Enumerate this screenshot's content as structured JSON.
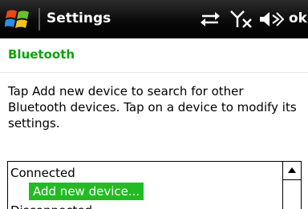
{
  "titlebar": {
    "title": "Settings",
    "ok_label": "ok",
    "start_icon": "windows-flag-icon",
    "status_icons": [
      "sync-arrows-icon",
      "no-signal-icon",
      "volume-muted-icon"
    ]
  },
  "section": {
    "title": "Bluetooth"
  },
  "description": "Tap Add new device to search for other Bluetooth devices. Tap on a device to modify its settings.",
  "device_list": {
    "group_connected": "Connected",
    "add_new_device": "Add new device...",
    "group_disconnected": "Disconnected"
  },
  "colors": {
    "accent_green": "#10a010",
    "selection_green": "#22bb22",
    "titlebar_black": "#000000"
  }
}
